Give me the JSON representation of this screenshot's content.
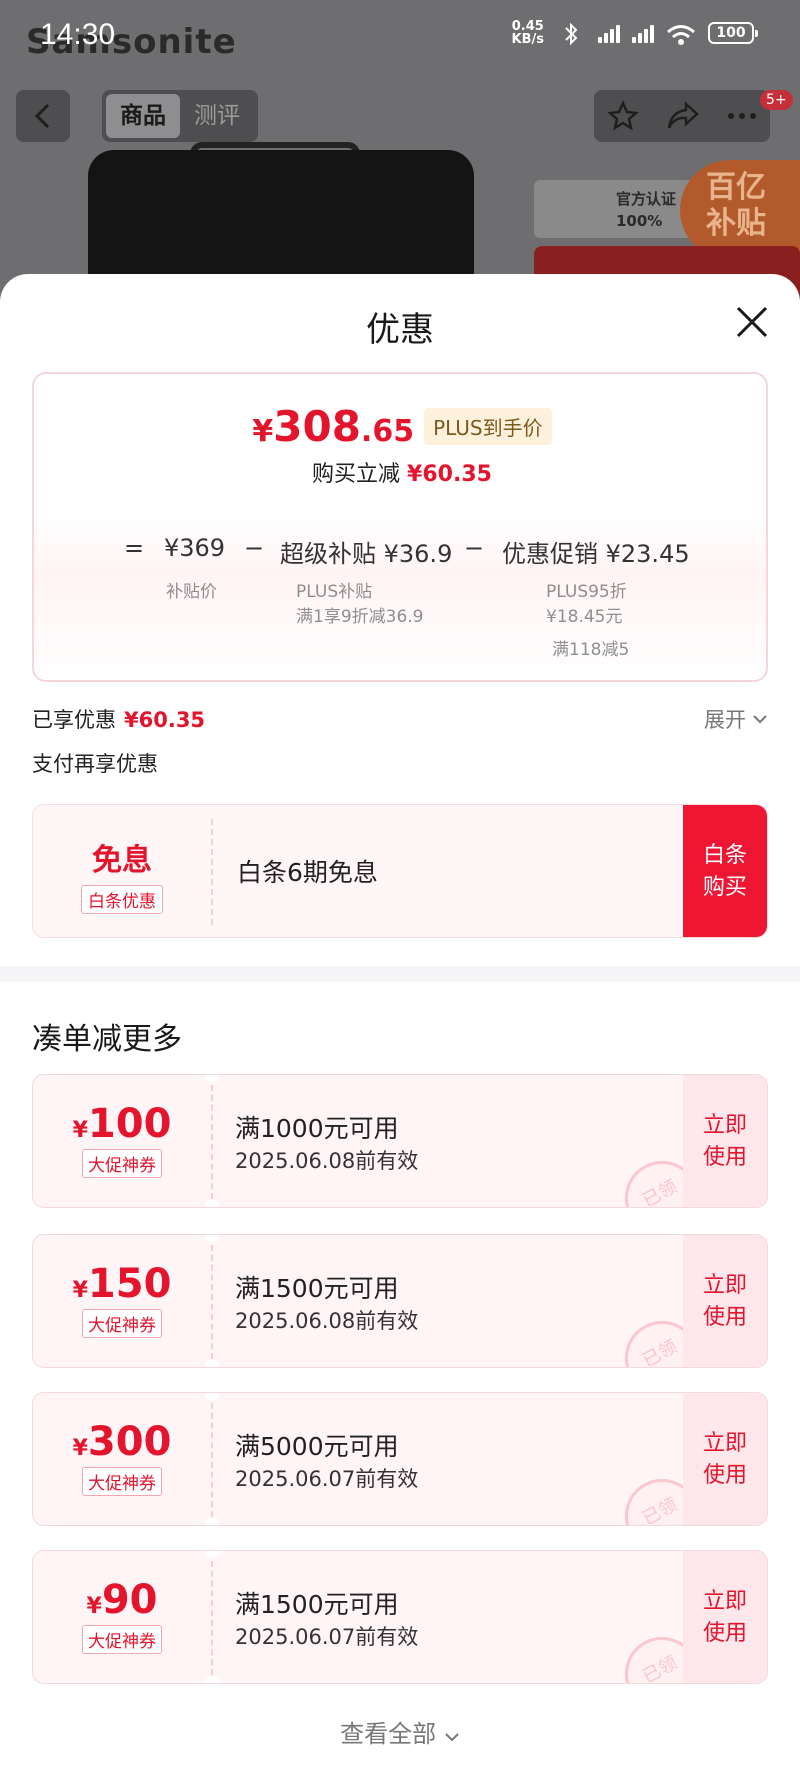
{
  "status_bar": {
    "time": "14:30",
    "net_speed_value": "0.45",
    "net_speed_unit": "KB/s",
    "battery": "100"
  },
  "background_page": {
    "brand": "Samsonite",
    "tabs": [
      {
        "label": "商品",
        "active": true
      },
      {
        "label": "测评",
        "active": false
      }
    ],
    "badge": "5+",
    "official_text_1": "官方认证",
    "official_text_2": "100%",
    "subsidy_text_1": "百亿",
    "subsidy_text_2": "补贴"
  },
  "sheet": {
    "title": "优惠",
    "price_card": {
      "currency": "¥",
      "price_int": "308",
      "price_dec": ".65",
      "plus_tag": "PLUS到手价",
      "reduce_label": "购买立减",
      "reduce_value": "¥60.35",
      "formula": {
        "equals": "=",
        "base_price": "¥369",
        "base_label": "补贴价",
        "minus": "−",
        "subsidy": "超级补贴 ¥36.9",
        "subsidy_sub_1": "PLUS补贴",
        "subsidy_sub_2": "满1享9折减36.9",
        "promo": "优惠促销 ¥23.45",
        "promo_sub_1": "PLUS95折",
        "promo_sub_2": "¥18.45元",
        "promo_sub_3": "满118减5"
      }
    },
    "enjoyed_label": "已享优惠",
    "enjoyed_value": "¥60.35",
    "expand_label": "展开",
    "pay_more_label": "支付再享优惠",
    "installment": {
      "big": "免息",
      "tag": "白条优惠",
      "text": "白条6期免息",
      "button_line1": "白条",
      "button_line2": "购买"
    },
    "more_title": "凑单减更多",
    "coupons": [
      {
        "currency": "¥",
        "amount": "100",
        "tag": "大促神券",
        "condition": "满1000元可用",
        "valid": "2025.06.08前有效",
        "btn1": "立即",
        "btn2": "使用",
        "stamp": "已领"
      },
      {
        "currency": "¥",
        "amount": "150",
        "tag": "大促神券",
        "condition": "满1500元可用",
        "valid": "2025.06.08前有效",
        "btn1": "立即",
        "btn2": "使用",
        "stamp": "已领"
      },
      {
        "currency": "¥",
        "amount": "300",
        "tag": "大促神券",
        "condition": "满5000元可用",
        "valid": "2025.06.07前有效",
        "btn1": "立即",
        "btn2": "使用",
        "stamp": "已领"
      },
      {
        "currency": "¥",
        "amount": "90",
        "tag": "大促神券",
        "condition": "满1500元可用",
        "valid": "2025.06.07前有效",
        "btn1": "立即",
        "btn2": "使用",
        "stamp": "已领"
      }
    ],
    "view_all": "查看全部"
  },
  "colors": {
    "accent_red": "#e4142c",
    "button_red": "#ee1632",
    "plus_gold": "#7c5a1e"
  },
  "icons": [
    "back-arrow-icon",
    "star-icon",
    "share-icon",
    "more-dots-icon",
    "close-icon",
    "chevron-down-icon",
    "bluetooth-icon",
    "wifi-icon",
    "signal-icon",
    "battery-icon"
  ]
}
